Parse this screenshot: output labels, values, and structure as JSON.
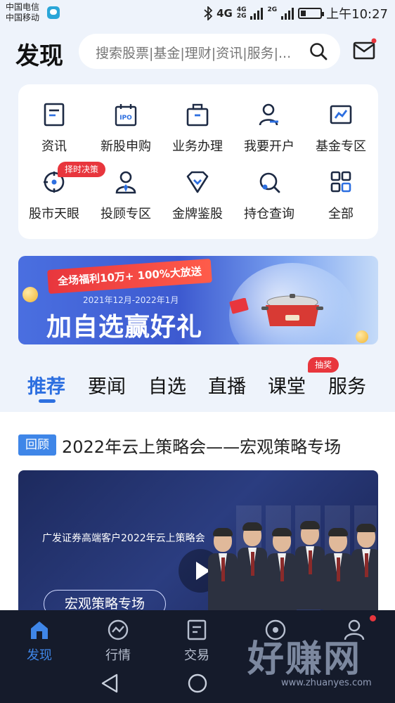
{
  "status_bar": {
    "carrier_1": "中国电信",
    "carrier_2": "中国移动",
    "net_main": "4G",
    "net_small_top": "4G",
    "net_small_bottom": "2G",
    "net_2g": "2G",
    "time": "上午10:27",
    "icons": [
      "app-notification-icon",
      "bluetooth-icon",
      "signal-icon",
      "battery-icon"
    ]
  },
  "header": {
    "title": "发现",
    "search_placeholder": "搜索股票|基金|理财|资讯|服务|...",
    "icons": [
      "search-icon",
      "mail-icon"
    ]
  },
  "shortcuts": [
    {
      "label": "资讯",
      "icon": "news-icon"
    },
    {
      "label": "新股申购",
      "icon": "ipo-icon",
      "icon_text": "IPO"
    },
    {
      "label": "业务办理",
      "icon": "briefcase-icon"
    },
    {
      "label": "我要开户",
      "icon": "open-account-icon"
    },
    {
      "label": "基金专区",
      "icon": "fund-chart-icon"
    },
    {
      "label": "股市天眼",
      "icon": "market-eye-icon",
      "badge": "择时决策"
    },
    {
      "label": "投顾专区",
      "icon": "advisor-icon"
    },
    {
      "label": "金牌鉴股",
      "icon": "gold-diamond-icon"
    },
    {
      "label": "持仓查询",
      "icon": "position-search-icon"
    },
    {
      "label": "全部",
      "icon": "grid-all-icon"
    }
  ],
  "banner": {
    "ribbon": "全场福利10万+ 100%大放送",
    "date": "2021年12月-2022年1月",
    "headline": "加自选赢好礼"
  },
  "tabs": {
    "items": [
      "推荐",
      "要闻",
      "自选",
      "直播",
      "课堂",
      "服务"
    ],
    "active_index": 0,
    "badge": "抽奖"
  },
  "feed": {
    "tag": "回顾",
    "title": "2022年云上策略会——宏观策略专场",
    "video_caption": "广发证券高端客户2022年云上策略会",
    "video_pill": "宏观策略专场"
  },
  "bottom_nav": {
    "items": [
      {
        "label": "发现",
        "icon": "home-icon"
      },
      {
        "label": "行情",
        "icon": "market-trend-icon"
      },
      {
        "label": "交易",
        "icon": "trade-icon"
      },
      {
        "label": "",
        "icon": "compass-icon"
      },
      {
        "label": "",
        "icon": "user-icon"
      }
    ],
    "active_index": 0
  },
  "watermark": {
    "main": "好赚网",
    "sub": "www.zhuanyes.com"
  },
  "colors": {
    "accent": "#2d6fe0",
    "badge_red": "#e8363d",
    "nav_bg": "#151b2b",
    "page_bg": "#eef3fb"
  }
}
